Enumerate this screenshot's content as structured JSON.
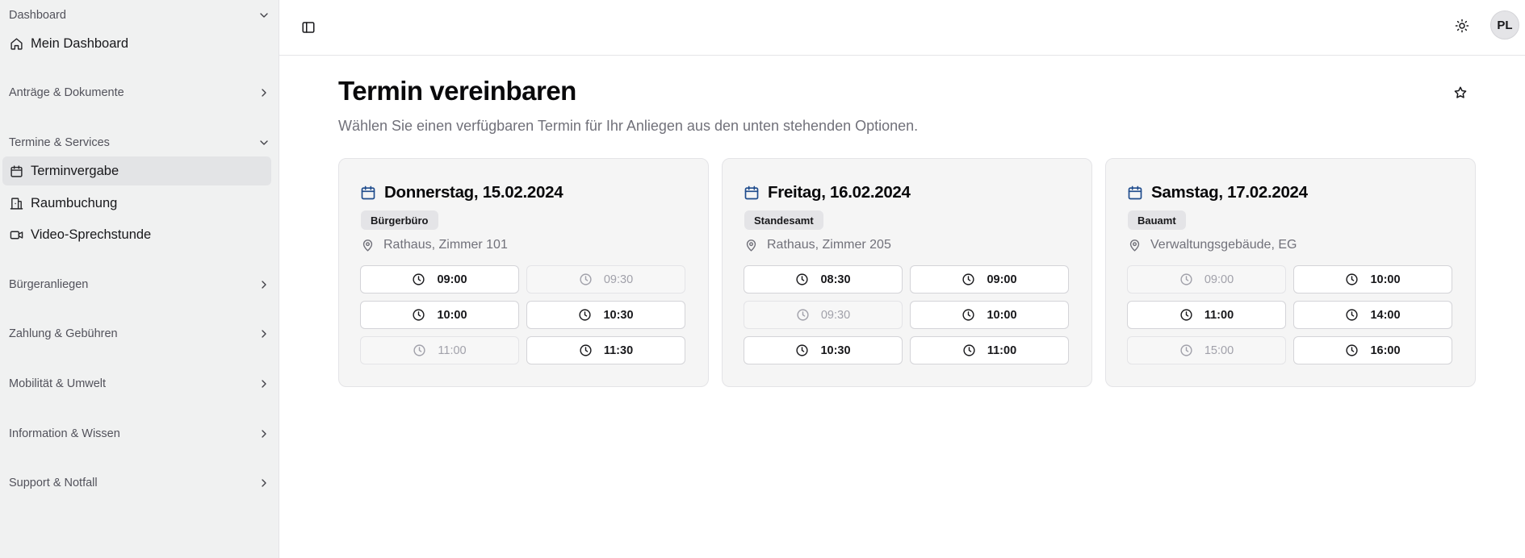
{
  "sidebar": {
    "groups": [
      {
        "label": "Dashboard",
        "expanded": true
      },
      {
        "label": "Anträge & Dokumente",
        "expanded": false
      },
      {
        "label": "Termine & Services",
        "expanded": true
      },
      {
        "label": "Bürgeranliegen",
        "expanded": false
      },
      {
        "label": "Zahlung & Gebühren",
        "expanded": false
      },
      {
        "label": "Mobilität & Umwelt",
        "expanded": false
      },
      {
        "label": "Information & Wissen",
        "expanded": false
      },
      {
        "label": "Support & Notfall",
        "expanded": false
      }
    ],
    "items": [
      {
        "label": "Mein Dashboard",
        "icon": "home-icon"
      },
      {
        "label": "Terminvergabe",
        "icon": "calendar-icon",
        "active": true
      },
      {
        "label": "Raumbuchung",
        "icon": "building-icon"
      },
      {
        "label": "Video-Sprechstunde",
        "icon": "video-icon"
      }
    ]
  },
  "header": {
    "avatar_initials": "PL"
  },
  "page": {
    "title": "Termin vereinbaren",
    "subtitle": "Wählen Sie einen verfügbaren Termin für Ihr Anliegen aus den unten stehenden Optionen."
  },
  "cards": [
    {
      "date": "Donnerstag, 15.02.2024",
      "office": "Bürgerbüro",
      "location": "Rathaus, Zimmer 101",
      "slots": [
        {
          "time": "09:00",
          "available": true
        },
        {
          "time": "09:30",
          "available": false
        },
        {
          "time": "10:00",
          "available": true
        },
        {
          "time": "10:30",
          "available": true
        },
        {
          "time": "11:00",
          "available": false
        },
        {
          "time": "11:30",
          "available": true
        }
      ]
    },
    {
      "date": "Freitag, 16.02.2024",
      "office": "Standesamt",
      "location": "Rathaus, Zimmer 205",
      "slots": [
        {
          "time": "08:30",
          "available": true
        },
        {
          "time": "09:00",
          "available": true
        },
        {
          "time": "09:30",
          "available": false
        },
        {
          "time": "10:00",
          "available": true
        },
        {
          "time": "10:30",
          "available": true
        },
        {
          "time": "11:00",
          "available": true
        }
      ]
    },
    {
      "date": "Samstag, 17.02.2024",
      "office": "Bauamt",
      "location": "Verwaltungsgebäude, EG",
      "slots": [
        {
          "time": "09:00",
          "available": false
        },
        {
          "time": "10:00",
          "available": true
        },
        {
          "time": "11:00",
          "available": true
        },
        {
          "time": "14:00",
          "available": true
        },
        {
          "time": "15:00",
          "available": false
        },
        {
          "time": "16:00",
          "available": true
        }
      ]
    }
  ]
}
